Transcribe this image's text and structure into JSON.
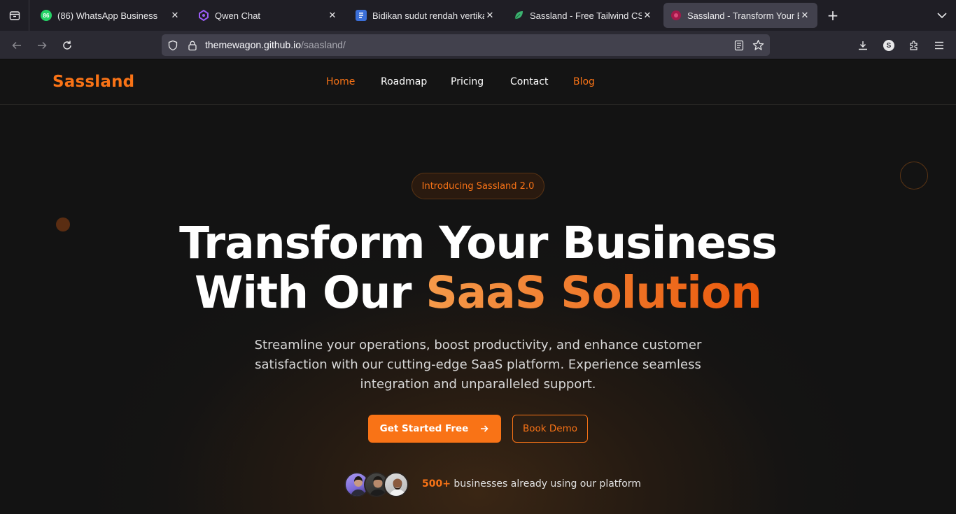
{
  "browser": {
    "tabs": [
      {
        "title": "(86) WhatsApp Business",
        "badge": "86",
        "icon": "whatsapp-icon",
        "active": false
      },
      {
        "title": "Qwen Chat",
        "icon": "qwen-icon",
        "active": false
      },
      {
        "title": "Bidikan sudut rendah vertika",
        "icon": "document-icon",
        "active": false
      },
      {
        "title": "Sassland - Free Tailwind CSS",
        "icon": "leaf-icon",
        "active": false
      },
      {
        "title": "Sassland - Transform Your Bu",
        "icon": "sassland-icon",
        "active": true
      }
    ],
    "url": {
      "host": "themewagon.github.io",
      "path": "/saasland/"
    },
    "profile_initial": "S"
  },
  "site": {
    "logo": "Sassland",
    "nav": [
      "Home",
      "Roadmap",
      "Pricing",
      "Contact",
      "Blog"
    ]
  },
  "hero": {
    "badge": "Introducing Sassland 2.0",
    "title_line1": "Transform Your Business",
    "title_line2_plain": "With Our ",
    "title_line2_accent": "SaaS Solution",
    "subtitle": "Streamline your operations, boost productivity, and enhance customer satisfaction with our cutting-edge SaaS platform. Experience seamless integration and unparalleled support.",
    "primary_cta": "Get Started Free",
    "secondary_cta": "Book Demo",
    "social_count": "500+",
    "social_text": " businesses already using our platform"
  },
  "colors": {
    "accent": "#f97316",
    "background": "#131313",
    "browser_tabbar": "#1f1e25",
    "browser_toolbar": "#2b2a33"
  }
}
